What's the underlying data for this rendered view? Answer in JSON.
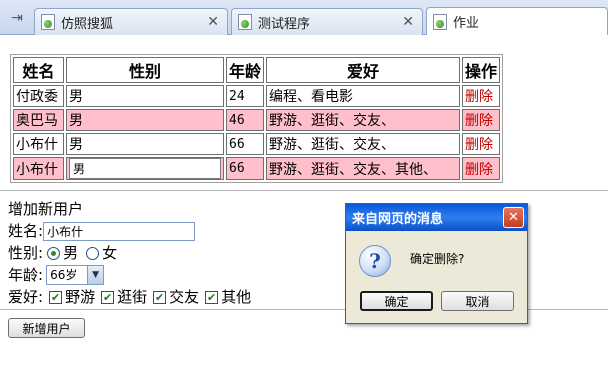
{
  "tabs": [
    {
      "label": "仿照搜狐",
      "close": "✕"
    },
    {
      "label": "测试程序",
      "close": "✕"
    },
    {
      "label": "作业"
    }
  ],
  "table": {
    "headers": [
      "姓名",
      "性别",
      "年龄",
      "爱好",
      "操作"
    ],
    "rows": [
      {
        "name": "付政委",
        "gender": "男",
        "age": "24",
        "hobby": "编程、看电影",
        "action": "删除"
      },
      {
        "name": "奥巴马",
        "gender": "男",
        "age": "46",
        "hobby": "野游、逛街、交友、",
        "action": "删除"
      },
      {
        "name": "小布什",
        "gender": "男",
        "age": "66",
        "hobby": "野游、逛街、交友、",
        "action": "删除"
      },
      {
        "name": "小布什",
        "gender": "男",
        "age": "66",
        "hobby": "野游、逛街、交友、其他、",
        "action": "删除"
      }
    ]
  },
  "form": {
    "title": "增加新用户",
    "name_label": "姓名:",
    "name_value": "小布什",
    "gender_label": "性别:",
    "gender_options": [
      "男",
      "女"
    ],
    "gender_selected": "男",
    "age_label": "年龄:",
    "age_value": "66岁",
    "hobby_label": "爱好:",
    "hobbies": [
      "野游",
      "逛街",
      "交友",
      "其他"
    ],
    "submit_label": "新增用户"
  },
  "dialog": {
    "title": "来自网页的消息",
    "message": "确定删除?",
    "ok_label": "确定",
    "cancel_label": "取消",
    "close": "✕"
  },
  "colors": {
    "highlight_row": "#ffc0cb",
    "delete_link": "#c00000",
    "dialog_title": "#0a58d8"
  }
}
